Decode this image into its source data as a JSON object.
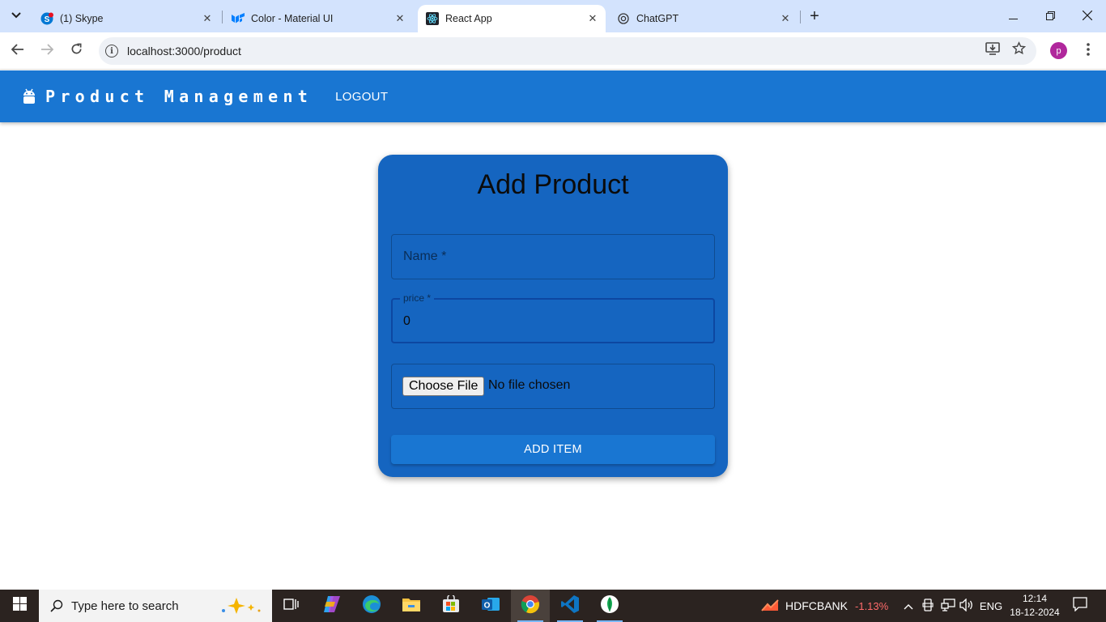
{
  "browser": {
    "tabs": [
      {
        "title": "(1) Skype",
        "icon": "skype-icon",
        "active": false
      },
      {
        "title": "Color - Material UI",
        "icon": "material-ui-icon",
        "active": false
      },
      {
        "title": "React App",
        "icon": "react-icon",
        "active": true
      },
      {
        "title": "ChatGPT",
        "icon": "chatgpt-icon",
        "active": false
      }
    ],
    "url": "localhost:3000/product",
    "profile_initial": "p"
  },
  "app": {
    "brand": "Product Management",
    "logout_label": "LOGOUT",
    "accent_color": "#1976d2",
    "card_color": "#1565c0"
  },
  "form": {
    "title": "Add Product",
    "name_placeholder": "Name *",
    "price_label": "price *",
    "price_value": "0",
    "file_button": "Choose File",
    "file_status": "No file chosen",
    "submit_label": "ADD ITEM"
  },
  "taskbar": {
    "search_placeholder": "Type here to search",
    "stock_name": "HDFCBANK",
    "stock_change": "-1.13%",
    "language": "ENG",
    "time": "12:14",
    "date": "18-12-2024"
  }
}
